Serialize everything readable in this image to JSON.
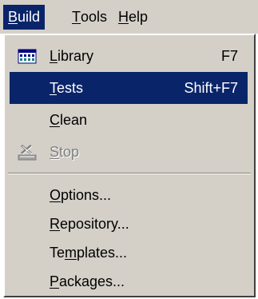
{
  "menubar": {
    "items": [
      {
        "pre": "",
        "acc": "B",
        "post": "uild"
      },
      {
        "pre": "",
        "acc": "T",
        "post": "ools"
      },
      {
        "pre": "",
        "acc": "H",
        "post": "elp"
      }
    ]
  },
  "menu": {
    "items": [
      {
        "pre": "",
        "acc": "L",
        "post": "ibrary",
        "shortcut": "F7",
        "icon": "library-icon"
      },
      {
        "pre": "",
        "acc": "T",
        "post": "ests",
        "shortcut": "Shift+F7"
      },
      {
        "pre": "",
        "acc": "C",
        "post": "lean",
        "shortcut": ""
      },
      {
        "pre": "",
        "acc": "S",
        "post": "top",
        "shortcut": "",
        "icon": "stop-icon"
      },
      {
        "pre": "",
        "acc": "O",
        "post": "ptions...",
        "shortcut": ""
      },
      {
        "pre": "",
        "acc": "R",
        "post": "epository...",
        "shortcut": ""
      },
      {
        "pre": "Te",
        "acc": "m",
        "post": "plates...",
        "shortcut": ""
      },
      {
        "pre": "",
        "acc": "P",
        "post": "ackages...",
        "shortcut": ""
      }
    ]
  },
  "colors": {
    "menu_bg": "#d4d0c8",
    "highlight": "#0a246a",
    "highlight_text": "#ffffff",
    "disabled_text": "#808080"
  }
}
